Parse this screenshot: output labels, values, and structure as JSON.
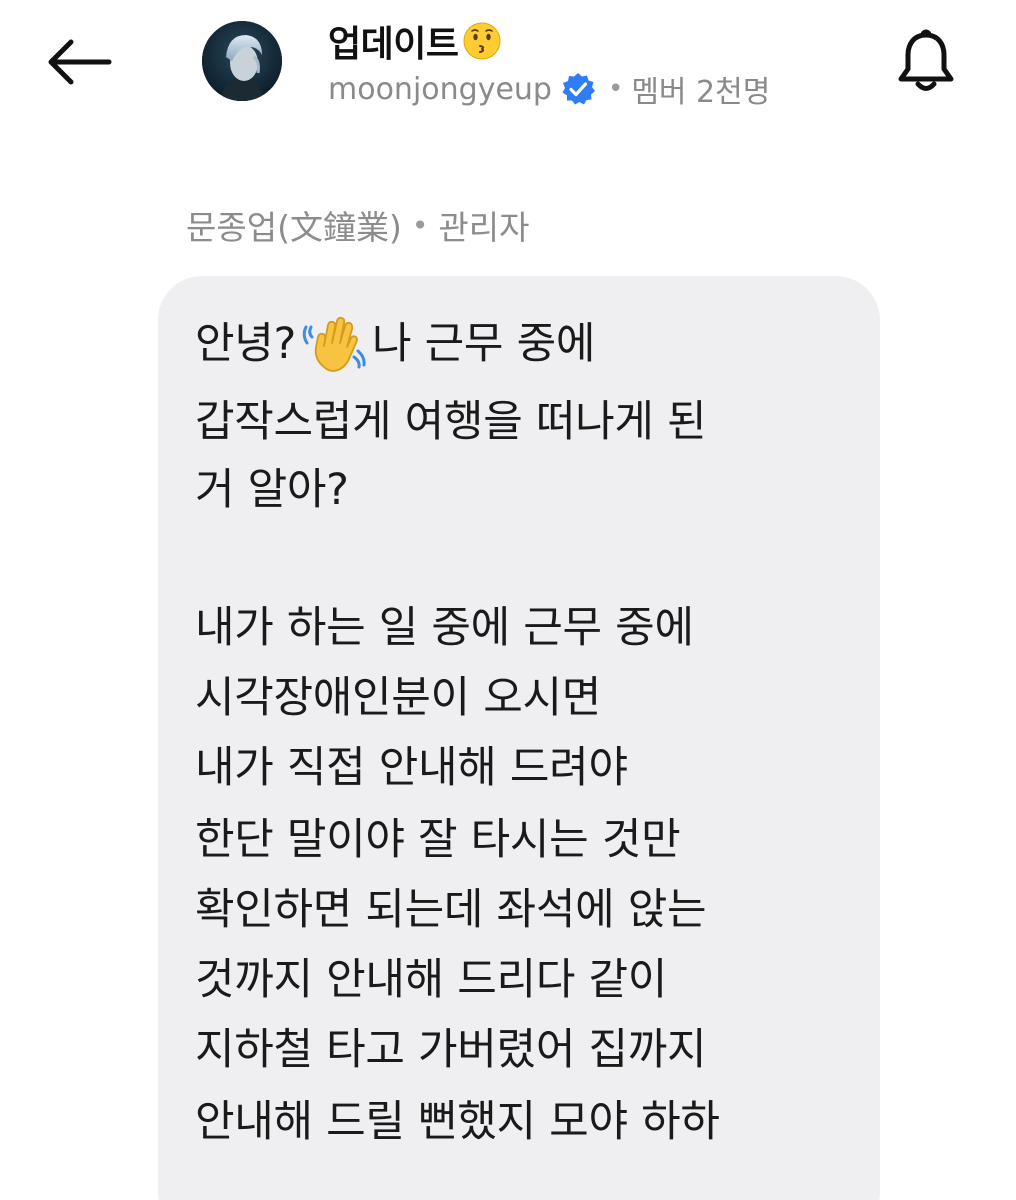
{
  "header": {
    "back_icon": "back-arrow-icon",
    "title": "업데이트",
    "title_emoji": "kissing-face-emoji",
    "username": "moonjongyeup",
    "verified_icon": "verified-badge-icon",
    "member_label": "멤버 2천명",
    "separator": "•",
    "bell_icon": "bell-icon"
  },
  "message": {
    "sender_name": "문종업(文鐘業)",
    "separator": "•",
    "sender_role": "관리자",
    "wave_emoji": "waving-hand-emoji",
    "line_1a": "안녕?",
    "line_1b": "나 근무 중에",
    "lines": [
      "갑작스럽게 여행을 떠나게 된",
      "거 알아?",
      "",
      "내가 하는 일 중에 근무 중에",
      "시각장애인분이 오시면",
      "내가 직접 안내해 드려야",
      "한단 말이야 잘 타시는 것만",
      "확인하면 되는데 좌석에 앉는",
      "것까지 안내해 드리다 같이",
      "지하철 타고 가버렸어 집까지",
      "안내해 드릴 뻔했지 모야 하하"
    ]
  },
  "colors": {
    "bubble_bg": "#efeff1",
    "verified_blue": "#2f7df6",
    "muted_text": "#8a8a8a"
  }
}
